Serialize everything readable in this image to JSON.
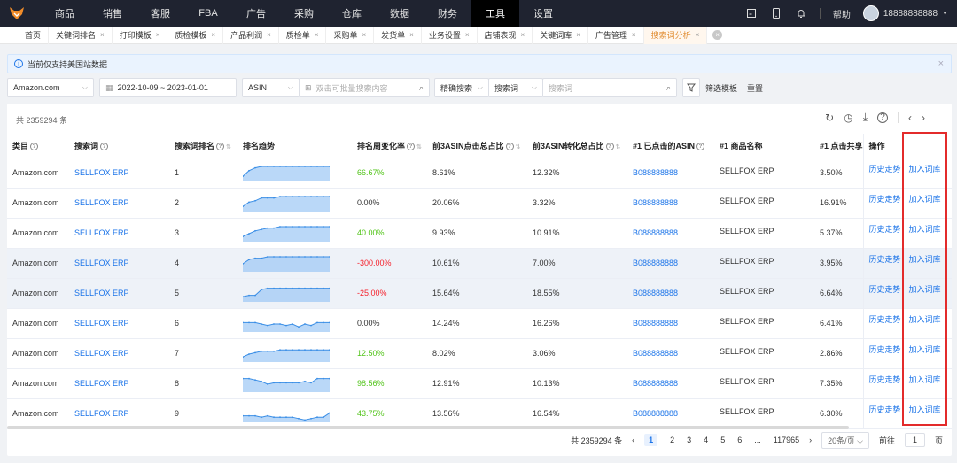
{
  "nav": {
    "items": [
      "商品",
      "销售",
      "客服",
      "FBA",
      "广告",
      "采购",
      "仓库",
      "数据",
      "财务",
      "工具",
      "设置"
    ],
    "active_index": 9,
    "help": "帮助",
    "user": "18888888888"
  },
  "tabs": {
    "items": [
      "首页",
      "关键词排名",
      "打印模板",
      "质检模板",
      "产品利润",
      "质检单",
      "采购单",
      "发货单",
      "业务设置",
      "店铺表现",
      "关键词库",
      "广告管理",
      "搜索词分析"
    ],
    "active_index": 12
  },
  "notice": "当前仅支持美国站数据",
  "filters": {
    "marketplace": "Amazon.com",
    "date_range": "2022-10-09 ~ 2023-01-01",
    "asin_type": "ASIN",
    "asin_placeholder": "双击可批量搜索内容",
    "match_type": "精确搜索",
    "search_field": "搜索词",
    "search_placeholder": "搜索词",
    "filter_template": "筛选模板",
    "reset": "重置"
  },
  "table": {
    "total_label": "共 2359294 条",
    "headers": [
      "类目",
      "搜索词",
      "搜索词排名",
      "排名趋势",
      "排名周变化率",
      "前3ASIN点击总占比",
      "前3ASIN转化总占比",
      "#1 已点击的ASIN",
      "#1 商品名称",
      "#1 点击共享",
      "操作"
    ],
    "rows": [
      {
        "category": "Amazon.com",
        "term": "SELLFOX ERP",
        "rank": "1",
        "change": "66.67%",
        "change_color": "green",
        "click": "8.61%",
        "conv": "12.32%",
        "asin": "B088888888",
        "name": "SELLFOX ERP",
        "share": "3.50%",
        "highlight": false
      },
      {
        "category": "Amazon.com",
        "term": "SELLFOX ERP",
        "rank": "2",
        "change": "0.00%",
        "change_color": "",
        "click": "20.06%",
        "conv": "3.32%",
        "asin": "B088888888",
        "name": "SELLFOX ERP",
        "share": "16.91%",
        "highlight": false
      },
      {
        "category": "Amazon.com",
        "term": "SELLFOX ERP",
        "rank": "3",
        "change": "40.00%",
        "change_color": "green",
        "click": "9.93%",
        "conv": "10.91%",
        "asin": "B088888888",
        "name": "SELLFOX ERP",
        "share": "5.37%",
        "highlight": false
      },
      {
        "category": "Amazon.com",
        "term": "SELLFOX ERP",
        "rank": "4",
        "change": "-300.00%",
        "change_color": "red",
        "click": "10.61%",
        "conv": "7.00%",
        "asin": "B088888888",
        "name": "SELLFOX ERP",
        "share": "3.95%",
        "highlight": true
      },
      {
        "category": "Amazon.com",
        "term": "SELLFOX ERP",
        "rank": "5",
        "change": "-25.00%",
        "change_color": "red",
        "click": "15.64%",
        "conv": "18.55%",
        "asin": "B088888888",
        "name": "SELLFOX ERP",
        "share": "6.64%",
        "highlight": true
      },
      {
        "category": "Amazon.com",
        "term": "SELLFOX ERP",
        "rank": "6",
        "change": "0.00%",
        "change_color": "",
        "click": "14.24%",
        "conv": "16.26%",
        "asin": "B088888888",
        "name": "SELLFOX ERP",
        "share": "6.41%",
        "highlight": false
      },
      {
        "category": "Amazon.com",
        "term": "SELLFOX ERP",
        "rank": "7",
        "change": "12.50%",
        "change_color": "green",
        "click": "8.02%",
        "conv": "3.06%",
        "asin": "B088888888",
        "name": "SELLFOX ERP",
        "share": "2.86%",
        "highlight": false
      },
      {
        "category": "Amazon.com",
        "term": "SELLFOX ERP",
        "rank": "8",
        "change": "98.56%",
        "change_color": "green",
        "click": "12.91%",
        "conv": "10.13%",
        "asin": "B088888888",
        "name": "SELLFOX ERP",
        "share": "7.35%",
        "highlight": false
      },
      {
        "category": "Amazon.com",
        "term": "SELLFOX ERP",
        "rank": "9",
        "change": "43.75%",
        "change_color": "green",
        "click": "13.56%",
        "conv": "16.54%",
        "asin": "B088888888",
        "name": "SELLFOX ERP",
        "share": "6.30%",
        "highlight": false
      }
    ],
    "op_history": "历史走势",
    "op_add": "加入词库",
    "trends": [
      [
        3,
        7,
        9,
        10,
        10,
        10,
        10,
        10,
        10,
        10,
        10,
        10,
        10,
        10,
        10
      ],
      [
        3,
        6,
        7,
        9,
        9,
        9,
        10,
        10,
        10,
        10,
        10,
        10,
        10,
        10,
        10
      ],
      [
        3,
        5,
        7,
        8,
        9,
        9,
        10,
        10,
        10,
        10,
        10,
        10,
        10,
        10,
        10
      ],
      [
        5,
        8,
        9,
        9,
        10,
        10,
        10,
        10,
        10,
        10,
        10,
        10,
        10,
        10,
        10
      ],
      [
        3,
        4,
        4,
        8,
        9,
        9,
        9,
        9,
        9,
        9,
        9,
        9,
        9,
        9,
        9
      ],
      [
        6,
        6,
        6,
        5,
        4,
        5,
        5,
        4,
        5,
        3,
        5,
        4,
        6,
        6,
        6
      ],
      [
        3,
        5,
        6,
        7,
        7,
        7,
        8,
        8,
        8,
        8,
        8,
        8,
        8,
        8,
        8
      ],
      [
        9,
        9,
        8,
        7,
        5,
        6,
        6,
        6,
        6,
        6,
        7,
        6,
        9,
        9,
        9
      ],
      [
        4,
        4,
        4,
        3,
        4,
        3,
        3,
        3,
        3,
        2,
        1,
        2,
        3,
        3,
        6
      ]
    ]
  },
  "pager": {
    "total": "共 2359294 条",
    "pages": [
      "1",
      "2",
      "3",
      "4",
      "5",
      "6",
      "...",
      "117965"
    ],
    "page_size": "20条/页",
    "goto_label": "前往",
    "goto_value": "1",
    "page_unit": "页"
  },
  "colors": {
    "accent": "#1a73e8",
    "highlight_box": "#e32b2b",
    "active_tab": "#e08a2c"
  }
}
